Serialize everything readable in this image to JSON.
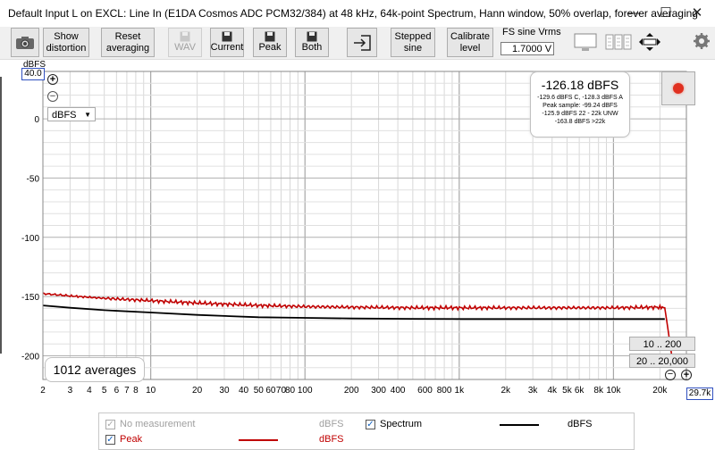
{
  "window": {
    "title": "Default Input L on EXCL: Line In (E1DA Cosmos ADC PCM32/384) at 48 kHz, 64k-point Spectrum, Hann window, 50% overlap, forever averaging",
    "minimize": "—",
    "maximize": "☐",
    "close": "✕"
  },
  "toolbar": {
    "show_distortion": [
      "Show",
      "distortion"
    ],
    "reset_averaging": [
      "Reset",
      "averaging"
    ],
    "wav": "WAV",
    "current": "Current",
    "peak": "Peak",
    "both": "Both",
    "stepped_sine": [
      "Stepped",
      "sine"
    ],
    "calibrate_level": [
      "Calibrate",
      "level"
    ],
    "fs_label": "FS sine Vrms",
    "fs_value": "1.7000 V"
  },
  "plot": {
    "y_unit_top": "dBFS",
    "y_max_box": "40.0",
    "x_max_box": "29.7k",
    "unit_dropdown": "dBFS",
    "averages": "1012 averages",
    "range_btn_1": "10 .. 200",
    "range_btn_2": "20 .. 20,000",
    "readout": {
      "main": "-126.18 dBFS",
      "line1": "-129.6 dBFS C, -128.3 dBFS A",
      "line2": "Peak sample: -99.24 dBFS",
      "line3": "-125.9 dBFS 22 - 22k UNW",
      "line4": "-163.8 dBFS >22k"
    }
  },
  "legend": {
    "no_measurement": "No measurement",
    "no_measurement_unit": "dBFS",
    "spectrum": "Spectrum",
    "spectrum_unit": "dBFS",
    "peak": "Peak",
    "peak_unit": "dBFS"
  },
  "colors": {
    "spectrum": "#000000",
    "peak": "#c00000",
    "record": "#e03020"
  },
  "chart_data": {
    "type": "line",
    "x_scale": "log",
    "xlim": [
      2,
      29700
    ],
    "ylim": [
      -220,
      40
    ],
    "x_ticks": [
      2,
      3,
      4,
      5,
      6,
      7,
      8,
      10,
      20,
      30,
      40,
      50,
      60,
      70,
      80,
      100,
      200,
      300,
      400,
      600,
      800,
      1000,
      2000,
      3000,
      4000,
      5000,
      6000,
      8000,
      10000,
      20000
    ],
    "x_tick_labels": [
      "2",
      "3",
      "4",
      "5",
      "6",
      "7",
      "8",
      "10",
      "20",
      "30",
      "40",
      "50",
      "60",
      "70",
      "80",
      "100",
      "200",
      "300",
      "400",
      "600",
      "800",
      "1k",
      "2k",
      "3k",
      "4k",
      "5k",
      "6k",
      "8k",
      "10k",
      "20k"
    ],
    "y_ticks": [
      0,
      -50,
      -100,
      -150,
      -200
    ],
    "y_tick_labels": [
      "0",
      "-50",
      "-100",
      "-150",
      "-200"
    ],
    "grid": true,
    "series": [
      {
        "name": "Spectrum",
        "x": [
          2,
          3,
          5,
          10,
          20,
          50,
          100,
          200,
          500,
          1000,
          2000,
          5000,
          10000,
          20000,
          21500
        ],
        "y": [
          -157.5,
          -159.5,
          -161.5,
          -163.5,
          -165.5,
          -167.5,
          -168.0,
          -168.5,
          -168.8,
          -169.0,
          -169.0,
          -169.0,
          -169.0,
          -169.0,
          -169.0
        ]
      },
      {
        "name": "Peak",
        "x": [
          2,
          3,
          5,
          10,
          20,
          50,
          100,
          200,
          500,
          1000,
          2000,
          5000,
          10000,
          20000,
          21500
        ],
        "y": [
          -147.5,
          -149.5,
          -151.5,
          -153.5,
          -155.5,
          -157.5,
          -158.5,
          -159.0,
          -159.5,
          -159.5,
          -159.5,
          -159.5,
          -159.5,
          -159.0,
          -159.5
        ]
      }
    ]
  }
}
